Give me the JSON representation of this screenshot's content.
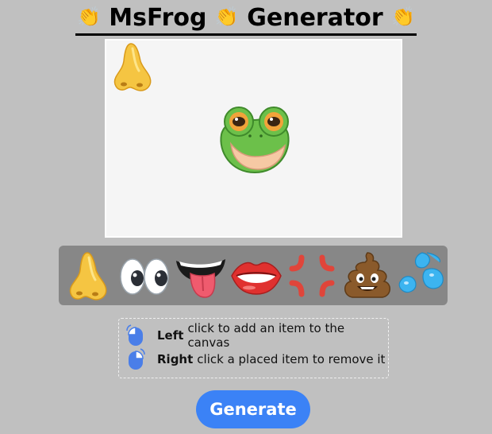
{
  "header": {
    "title_emoji": "👏",
    "title_word1": "MsFrog",
    "title_word2": "Generator"
  },
  "palette": {
    "items": [
      {
        "name": "nose"
      },
      {
        "name": "eyes"
      },
      {
        "name": "tongue-mouth"
      },
      {
        "name": "lips"
      },
      {
        "name": "anger-symbol"
      },
      {
        "name": "poop"
      },
      {
        "name": "sweat-droplets"
      }
    ]
  },
  "canvas": {
    "placed_items": [
      {
        "name": "nose"
      },
      {
        "name": "frog-face"
      }
    ]
  },
  "help": {
    "left_bold": "Left",
    "left_text": "click to add an item to the canvas",
    "right_bold": "Right",
    "right_text": "click a placed item to remove it"
  },
  "actions": {
    "generate_label": "Generate"
  },
  "colors": {
    "background": "#c0c0c0",
    "canvas": "#f5f5f5",
    "palette": "#878787",
    "button": "#3b82f6",
    "mouse_icon": "#3b82f6"
  }
}
